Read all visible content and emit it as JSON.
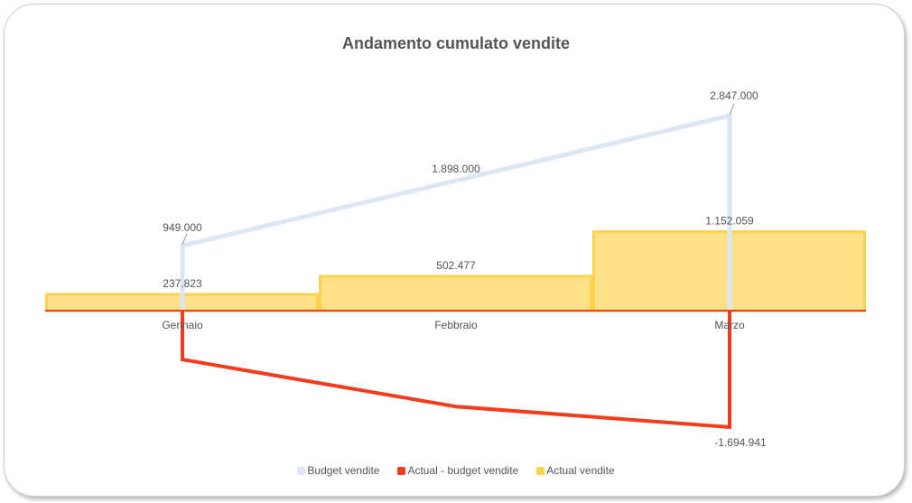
{
  "chart_data": {
    "type": "area",
    "title": "Andamento cumulato vendite",
    "categories": [
      "Gennaio",
      "Febbraio",
      "Marzo"
    ],
    "series": [
      {
        "name": "Budget vendite",
        "type": "line",
        "color": "#dce7f5",
        "values": [
          949000,
          1898000,
          2847000
        ]
      },
      {
        "name": "Actual - budget vendite",
        "type": "line",
        "color": "#f23c1b",
        "values": [
          -711177,
          -1395523,
          -1694941
        ]
      },
      {
        "name": "Actual vendite",
        "type": "step-area",
        "color": "#fcd24f",
        "values": [
          237823,
          502477,
          1152059
        ]
      }
    ],
    "data_labels": {
      "budget": [
        "949.000",
        "1.898.000",
        "2.847.000"
      ],
      "actual": [
        "237.823",
        "502.477",
        "1.152.059"
      ],
      "diff_last": "-1.694.941"
    },
    "ylim": [
      -1694941,
      2847000
    ],
    "grid": false,
    "legend_position": "bottom"
  }
}
